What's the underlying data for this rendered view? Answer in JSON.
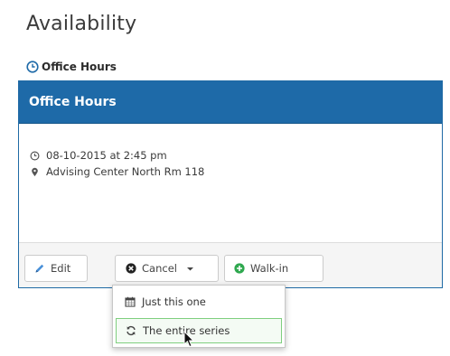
{
  "page": {
    "title": "Availability",
    "tab_label": "Office Hours"
  },
  "panel": {
    "title": "Office Hours",
    "datetime": "08-10-2015 at 2:45 pm",
    "location": "Advising Center North Rm 118"
  },
  "actions": {
    "edit_label": "Edit",
    "cancel_label": "Cancel",
    "walkin_label": "Walk-in"
  },
  "cancel_menu": {
    "items": [
      {
        "label": "Just this one",
        "icon": "calendar-icon"
      },
      {
        "label": "The entire series",
        "icon": "refresh-icon"
      }
    ]
  },
  "colors": {
    "header_blue": "#1e6aa8",
    "walkin_green": "#2fa84f",
    "highlight_green": "#7fcf7f"
  }
}
